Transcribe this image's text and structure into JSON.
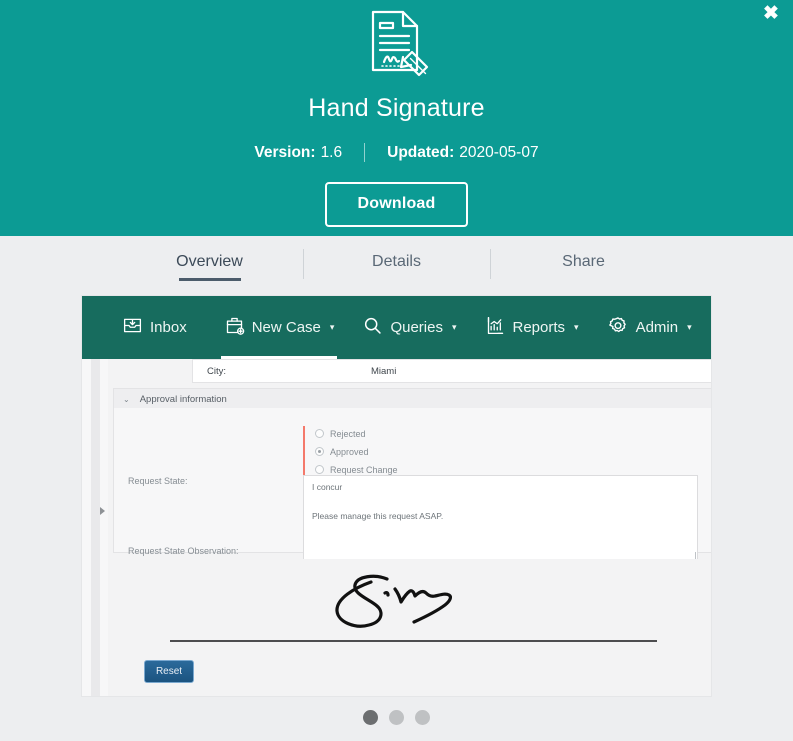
{
  "window": {
    "close_label": "✖"
  },
  "hero": {
    "icon": "signed-document-pencil-icon",
    "title": "Hand Signature",
    "version_key": "Version:",
    "version_value": "1.6",
    "updated_key": "Updated:",
    "updated_value": "2020-05-07",
    "download_label": "Download",
    "bg_color": "#0c9b94"
  },
  "tabs": [
    {
      "label": "Overview",
      "active": true
    },
    {
      "label": "Details",
      "active": false
    },
    {
      "label": "Share",
      "active": false
    }
  ],
  "screenshot": {
    "nav": {
      "bg_color": "#176c5e",
      "items": [
        {
          "label": "Inbox",
          "icon": "inbox-tray-icon",
          "caret": "",
          "active": false
        },
        {
          "label": "New Case",
          "icon": "briefcase-plus-icon",
          "caret": "▾",
          "active": true
        },
        {
          "label": "Queries",
          "icon": "magnifier-icon",
          "caret": "▾",
          "active": false
        },
        {
          "label": "Reports",
          "icon": "bar-chart-icon",
          "caret": "▾",
          "active": false
        },
        {
          "label": "Admin",
          "icon": "gear-icon",
          "caret": "▾",
          "active": false
        }
      ]
    },
    "form": {
      "city_label": "City:",
      "city_value": "Miami",
      "section_title": "Approval information",
      "section_chevron": "⌄",
      "request_state_label": "Request State:",
      "request_state_options": [
        {
          "label": "Rejected",
          "selected": false
        },
        {
          "label": "Approved",
          "selected": true
        },
        {
          "label": "Request Change",
          "selected": false
        }
      ],
      "observation_label": "Request State Observation:",
      "observation_line1": "I concur",
      "observation_line2": "Please manage this request ASAP.",
      "reset_label": "Reset",
      "reset_color": "#1d5a8a",
      "accent_color": "#f4796b",
      "signature_alt": "handwritten-signature"
    }
  },
  "carousel": {
    "dots": [
      {
        "active": true
      },
      {
        "active": false
      },
      {
        "active": false
      }
    ]
  }
}
